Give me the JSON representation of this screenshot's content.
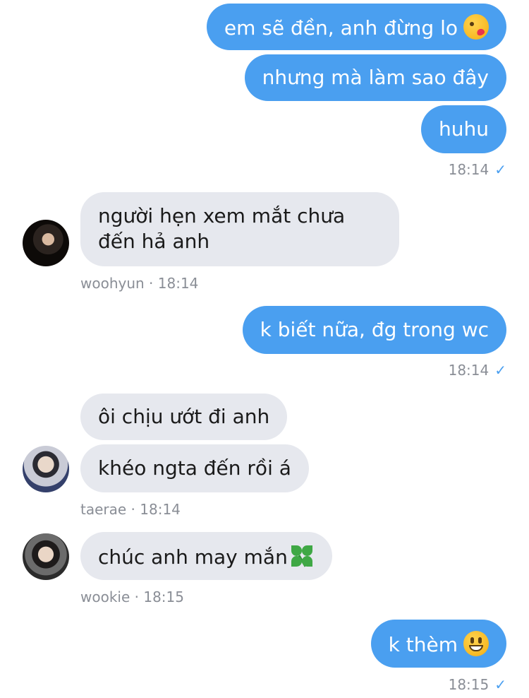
{
  "messages": {
    "m1": {
      "text": "em sẽ đền, anh đừng lo",
      "emoji": "face-blowing-kiss-emoji"
    },
    "m2": {
      "text": "nhưng mà làm sao đây"
    },
    "m3": {
      "text": "huhu"
    },
    "m3_time": "18:14",
    "m4": {
      "text": "người hẹn xem mắt chưa đến hả anh"
    },
    "m4_meta": "woohyun · 18:14",
    "m5": {
      "text": "k biết nữa, đg trong wc"
    },
    "m5_time": "18:14",
    "m6": {
      "text": "ôi chịu ướt đi anh"
    },
    "m7": {
      "text": "khéo ngta đến rồi á"
    },
    "m7_meta": "taerae · 18:14",
    "m8": {
      "text": "chúc anh may mắn",
      "emoji": "four-leaf-clover-emoji"
    },
    "m8_meta": "wookie · 18:15",
    "m9": {
      "text": "k thèm",
      "emoji": "grinning-face-emoji"
    },
    "m9_time": "18:15",
    "check_glyph": "✓"
  },
  "colors": {
    "outgoing_bubble": "#4a9ff0",
    "incoming_bubble": "#e6e8ee",
    "meta_text": "#8a8e96"
  }
}
